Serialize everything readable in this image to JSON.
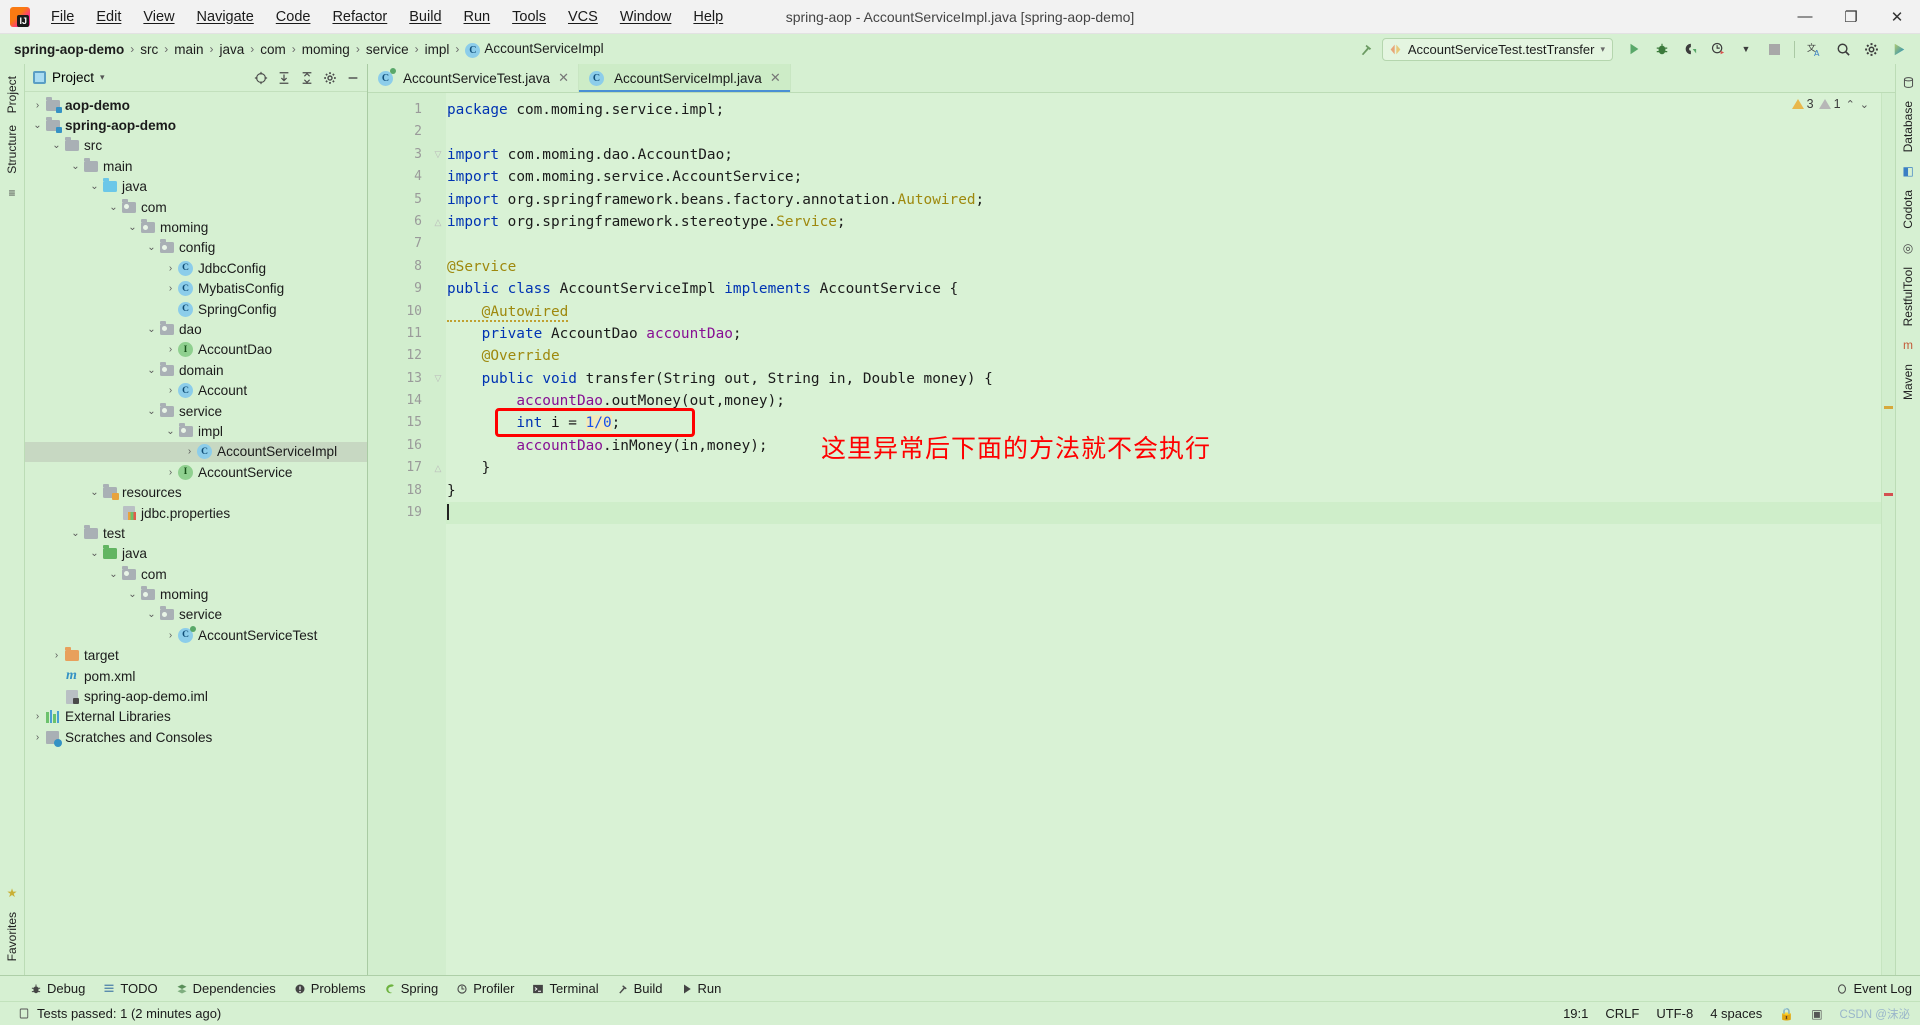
{
  "window": {
    "title": "spring-aop - AccountServiceImpl.java [spring-aop-demo]",
    "minimize": "—",
    "maximize": "❐",
    "close": "✕"
  },
  "menu": {
    "items": [
      "File",
      "Edit",
      "View",
      "Navigate",
      "Code",
      "Refactor",
      "Build",
      "Run",
      "Tools",
      "VCS",
      "Window",
      "Help"
    ]
  },
  "breadcrumb": {
    "items": [
      {
        "label": "spring-aop-demo",
        "bold": true,
        "icon": ""
      },
      {
        "label": "src",
        "bold": false,
        "icon": ""
      },
      {
        "label": "main",
        "bold": false,
        "icon": ""
      },
      {
        "label": "java",
        "bold": false,
        "icon": ""
      },
      {
        "label": "com",
        "bold": false,
        "icon": ""
      },
      {
        "label": "moming",
        "bold": false,
        "icon": ""
      },
      {
        "label": "service",
        "bold": false,
        "icon": ""
      },
      {
        "label": "impl",
        "bold": false,
        "icon": ""
      },
      {
        "label": "AccountServiceImpl",
        "bold": false,
        "icon": "class-icon"
      }
    ],
    "separator": "›"
  },
  "toolbar": {
    "run_config": "AccountServiceTest.testTransfer",
    "run_config_dropdown": "▾",
    "build_icon": "hammer-icon",
    "run_icon": "run-icon",
    "debug_icon": "debug-icon",
    "coverage_icon": "coverage-icon",
    "profiler_icon": "profiler-icon",
    "stop_icon": "stop-icon",
    "translate_icon": "translate-icon",
    "search_icon": "search-icon",
    "settings_icon": "settings-icon",
    "updates_icon": "updates-icon"
  },
  "left_rail": {
    "tabs": [
      "Project",
      "Structure"
    ],
    "bottom_tabs": [
      "Favorites"
    ]
  },
  "right_rail": {
    "tabs": [
      "Database",
      "Codota",
      "RestfulTool",
      "Maven"
    ]
  },
  "project_panel": {
    "title": "Project",
    "title_dropdown": "▾",
    "tools": {
      "locate": "crosshair-icon",
      "expand_all": "expand-all-icon",
      "collapse_all": "collapse-all-icon",
      "settings": "gear-icon",
      "hide": "minimize-icon"
    },
    "tree": [
      {
        "label": "aop-demo",
        "depth": 0,
        "arrow": "›",
        "icon": "module-folder",
        "bold": true,
        "sel": false
      },
      {
        "label": "spring-aop-demo",
        "depth": 0,
        "arrow": "⌄",
        "icon": "module-folder",
        "bold": true,
        "sel": false
      },
      {
        "label": "src",
        "depth": 1,
        "arrow": "⌄",
        "icon": "folder-gray",
        "bold": false,
        "sel": false
      },
      {
        "label": "main",
        "depth": 2,
        "arrow": "⌄",
        "icon": "folder-gray",
        "bold": false,
        "sel": false
      },
      {
        "label": "java",
        "depth": 3,
        "arrow": "⌄",
        "icon": "folder-source",
        "bold": false,
        "sel": false
      },
      {
        "label": "com",
        "depth": 4,
        "arrow": "⌄",
        "icon": "folder-pkg",
        "bold": false,
        "sel": false
      },
      {
        "label": "moming",
        "depth": 5,
        "arrow": "⌄",
        "icon": "folder-pkg",
        "bold": false,
        "sel": false
      },
      {
        "label": "config",
        "depth": 6,
        "arrow": "⌄",
        "icon": "folder-pkg",
        "bold": false,
        "sel": false
      },
      {
        "label": "JdbcConfig",
        "depth": 7,
        "arrow": "›",
        "icon": "class-icon",
        "bold": false,
        "sel": false
      },
      {
        "label": "MybatisConfig",
        "depth": 7,
        "arrow": "›",
        "icon": "class-icon",
        "bold": false,
        "sel": false
      },
      {
        "label": "SpringConfig",
        "depth": 7,
        "arrow": "",
        "icon": "class-icon",
        "bold": false,
        "sel": false
      },
      {
        "label": "dao",
        "depth": 6,
        "arrow": "⌄",
        "icon": "folder-pkg",
        "bold": false,
        "sel": false
      },
      {
        "label": "AccountDao",
        "depth": 7,
        "arrow": "›",
        "icon": "interface-icon",
        "bold": false,
        "sel": false
      },
      {
        "label": "domain",
        "depth": 6,
        "arrow": "⌄",
        "icon": "folder-pkg",
        "bold": false,
        "sel": false
      },
      {
        "label": "Account",
        "depth": 7,
        "arrow": "›",
        "icon": "class-icon",
        "bold": false,
        "sel": false
      },
      {
        "label": "service",
        "depth": 6,
        "arrow": "⌄",
        "icon": "folder-pkg",
        "bold": false,
        "sel": false
      },
      {
        "label": "impl",
        "depth": 7,
        "arrow": "⌄",
        "icon": "folder-pkg",
        "bold": false,
        "sel": false
      },
      {
        "label": "AccountServiceImpl",
        "depth": 8,
        "arrow": "›",
        "icon": "class-icon",
        "bold": false,
        "sel": true
      },
      {
        "label": "AccountService",
        "depth": 7,
        "arrow": "›",
        "icon": "interface-icon",
        "bold": false,
        "sel": false
      },
      {
        "label": "resources",
        "depth": 3,
        "arrow": "⌄",
        "icon": "folder-res",
        "bold": false,
        "sel": false
      },
      {
        "label": "jdbc.properties",
        "depth": 4,
        "arrow": "",
        "icon": "properties-icon",
        "bold": false,
        "sel": false
      },
      {
        "label": "test",
        "depth": 2,
        "arrow": "⌄",
        "icon": "folder-gray",
        "bold": false,
        "sel": false
      },
      {
        "label": "java",
        "depth": 3,
        "arrow": "⌄",
        "icon": "folder-test",
        "bold": false,
        "sel": false
      },
      {
        "label": "com",
        "depth": 4,
        "arrow": "⌄",
        "icon": "folder-pkg",
        "bold": false,
        "sel": false
      },
      {
        "label": "moming",
        "depth": 5,
        "arrow": "⌄",
        "icon": "folder-pkg",
        "bold": false,
        "sel": false
      },
      {
        "label": "service",
        "depth": 6,
        "arrow": "⌄",
        "icon": "folder-pkg",
        "bold": false,
        "sel": false
      },
      {
        "label": "AccountServiceTest",
        "depth": 7,
        "arrow": "›",
        "icon": "test-class-icon",
        "bold": false,
        "sel": false
      },
      {
        "label": "target",
        "depth": 1,
        "arrow": "›",
        "icon": "folder-excluded",
        "bold": false,
        "sel": false
      },
      {
        "label": "pom.xml",
        "depth": 1,
        "arrow": "",
        "icon": "maven-icon",
        "bold": false,
        "sel": false
      },
      {
        "label": "spring-aop-demo.iml",
        "depth": 1,
        "arrow": "",
        "icon": "iml-icon",
        "bold": false,
        "sel": false
      },
      {
        "label": "External Libraries",
        "depth": 0,
        "arrow": "›",
        "icon": "library-icon",
        "bold": false,
        "sel": false
      },
      {
        "label": "Scratches and Consoles",
        "depth": 0,
        "arrow": "›",
        "icon": "scratches-icon",
        "bold": false,
        "sel": false
      }
    ]
  },
  "editor": {
    "tabs": [
      {
        "label": "AccountServiceTest.java",
        "icon": "test-class-icon",
        "active": false,
        "close": "✕"
      },
      {
        "label": "AccountServiceImpl.java",
        "icon": "class-icon",
        "active": true,
        "close": "✕"
      }
    ],
    "inspections": {
      "warnings": "3",
      "weak_warnings": "1",
      "up_arrow": "⌃",
      "down_arrow": "⌄"
    },
    "line_numbers": [
      "1",
      "2",
      "3",
      "4",
      "5",
      "6",
      "7",
      "8",
      "9",
      "10",
      "11",
      "12",
      "13",
      "14",
      "15",
      "16",
      "17",
      "18",
      "19"
    ],
    "lines": [
      [
        {
          "t": "package ",
          "c": "kw"
        },
        {
          "t": "com.moming.service.impl;",
          "c": "typ"
        }
      ],
      [],
      [
        {
          "t": "import ",
          "c": "kw"
        },
        {
          "t": "com.moming.dao.AccountDao;",
          "c": "typ"
        }
      ],
      [
        {
          "t": "import ",
          "c": "kw"
        },
        {
          "t": "com.moming.service.AccountService;",
          "c": "typ"
        }
      ],
      [
        {
          "t": "import ",
          "c": "kw"
        },
        {
          "t": "org.springframework.beans.factory.annotation.",
          "c": "typ"
        },
        {
          "t": "Autowired",
          "c": "ann"
        },
        {
          "t": ";",
          "c": "typ"
        }
      ],
      [
        {
          "t": "import ",
          "c": "kw"
        },
        {
          "t": "org.springframework.stereotype.",
          "c": "typ"
        },
        {
          "t": "Service",
          "c": "ann"
        },
        {
          "t": ";",
          "c": "typ"
        }
      ],
      [],
      [
        {
          "t": "@Service",
          "c": "ann"
        }
      ],
      [
        {
          "t": "public ",
          "c": "kw"
        },
        {
          "t": "class ",
          "c": "kw"
        },
        {
          "t": "AccountServiceImpl ",
          "c": "typ"
        },
        {
          "t": "implements ",
          "c": "kw"
        },
        {
          "t": "AccountService {",
          "c": "typ"
        }
      ],
      [
        {
          "t": "    @Autowired",
          "c": "ann warnu"
        }
      ],
      [
        {
          "t": "    ",
          "c": "typ"
        },
        {
          "t": "private ",
          "c": "kw"
        },
        {
          "t": "AccountDao ",
          "c": "typ"
        },
        {
          "t": "accountDao",
          "c": "fld"
        },
        {
          "t": ";",
          "c": "typ"
        }
      ],
      [
        {
          "t": "    @Override",
          "c": "ann"
        }
      ],
      [
        {
          "t": "    ",
          "c": "typ"
        },
        {
          "t": "public ",
          "c": "kw"
        },
        {
          "t": "void ",
          "c": "kw"
        },
        {
          "t": "transfer",
          "c": "mth"
        },
        {
          "t": "(String out, String in, Double money) {",
          "c": "typ"
        }
      ],
      [
        {
          "t": "        ",
          "c": "typ"
        },
        {
          "t": "accountDao",
          "c": "fld"
        },
        {
          "t": ".outMoney(out,money);",
          "c": "typ"
        }
      ],
      [
        {
          "t": "        ",
          "c": "typ"
        },
        {
          "t": "int ",
          "c": "kw"
        },
        {
          "t": "i = ",
          "c": "typ"
        },
        {
          "t": "1/0",
          "c": "num err-hl"
        },
        {
          "t": ";",
          "c": "typ"
        }
      ],
      [
        {
          "t": "        ",
          "c": "typ"
        },
        {
          "t": "accountDao",
          "c": "fld"
        },
        {
          "t": ".inMoney(in,money);",
          "c": "typ"
        }
      ],
      [
        {
          "t": "    }",
          "c": "typ"
        }
      ],
      [
        {
          "t": "}",
          "c": "typ"
        }
      ],
      []
    ],
    "annotation": "这里异常后下面的方法就不会执行",
    "annotation_color": "#ff0000",
    "gutter_marks": {
      "line": "13",
      "implement_icon": "I",
      "override_arrow": "↑"
    }
  },
  "tool_windows": {
    "items": [
      {
        "label": "Debug",
        "icon": "debug-icon"
      },
      {
        "label": "TODO",
        "icon": "todo-icon"
      },
      {
        "label": "Dependencies",
        "icon": "dependencies-icon"
      },
      {
        "label": "Problems",
        "icon": "problems-icon"
      },
      {
        "label": "Spring",
        "icon": "spring-icon"
      },
      {
        "label": "Profiler",
        "icon": "profiler-icon"
      },
      {
        "label": "Terminal",
        "icon": "terminal-icon"
      },
      {
        "label": "Build",
        "icon": "build-icon"
      },
      {
        "label": "Run",
        "icon": "run-icon"
      }
    ],
    "event_log": "Event Log"
  },
  "status_bar": {
    "message": "Tests passed: 1 (2 minutes ago)",
    "caret_position": "19:1",
    "line_separator": "CRLF",
    "encoding": "UTF-8",
    "indent": "4 spaces",
    "watermark": "CSDN @沫泌"
  }
}
